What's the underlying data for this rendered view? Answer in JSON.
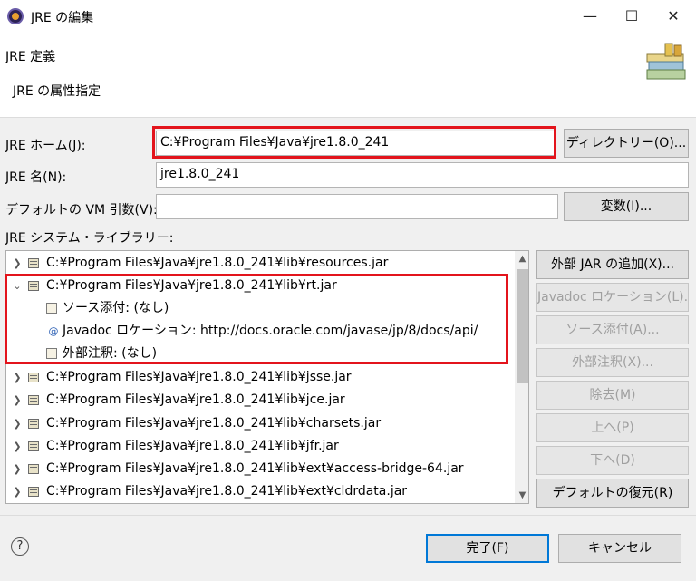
{
  "window": {
    "title": "JRE の編集",
    "minimize_glyph": "—",
    "maximize_glyph": "☐",
    "close_glyph": "✕"
  },
  "header": {
    "title": "JRE 定義",
    "description": "JRE の属性指定"
  },
  "form": {
    "jre_home_label": "JRE ホーム(J):",
    "jre_home_value": "C:¥Program Files¥Java¥jre1.8.0_241",
    "directory_button": "ディレクトリー(O)...",
    "jre_name_label": "JRE 名(N):",
    "jre_name_value": "jre1.8.0_241",
    "vm_args_label": "デフォルトの VM 引数(V):",
    "vm_args_value": "",
    "variables_button": "変数(I)...",
    "library_label": "JRE システム・ライブラリー:"
  },
  "tree": {
    "rows": [
      {
        "text": "C:¥Program Files¥Java¥jre1.8.0_241¥lib¥resources.jar",
        "expanded": false
      },
      {
        "text": "C:¥Program Files¥Java¥jre1.8.0_241¥lib¥rt.jar",
        "expanded": true
      },
      {
        "text": "ソース添付: (なし)",
        "child": true,
        "icon": "source-attachment-icon"
      },
      {
        "text": "Javadoc ロケーション: http://docs.oracle.com/javase/jp/8/docs/api/",
        "child": true,
        "icon": "javadoc-icon"
      },
      {
        "text": "外部注釈: (なし)",
        "child": true,
        "icon": "external-annotation-icon"
      },
      {
        "text": "C:¥Program Files¥Java¥jre1.8.0_241¥lib¥jsse.jar",
        "expanded": false
      },
      {
        "text": "C:¥Program Files¥Java¥jre1.8.0_241¥lib¥jce.jar",
        "expanded": false
      },
      {
        "text": "C:¥Program Files¥Java¥jre1.8.0_241¥lib¥charsets.jar",
        "expanded": false
      },
      {
        "text": "C:¥Program Files¥Java¥jre1.8.0_241¥lib¥jfr.jar",
        "expanded": false
      },
      {
        "text": "C:¥Program Files¥Java¥jre1.8.0_241¥lib¥ext¥access-bridge-64.jar",
        "expanded": false
      },
      {
        "text": "C:¥Program Files¥Java¥jre1.8.0_241¥lib¥ext¥cldrdata.jar",
        "expanded": false
      }
    ]
  },
  "side_buttons": {
    "add_external_jar": "外部 JAR の追加(X)...",
    "javadoc_location": "Javadoc ロケーション(L)...",
    "source_attachment": "ソース添付(A)...",
    "external_annotations": "外部注釈(X)...",
    "remove": "除去(M)",
    "up": "上へ(P)",
    "down": "下へ(D)",
    "restore_default": "デフォルトの復元(R)"
  },
  "footer": {
    "help_glyph": "?",
    "finish": "完了(F)",
    "cancel": "キャンセル"
  },
  "colors": {
    "highlight": "#e3141c",
    "focus": "#0078d7"
  }
}
